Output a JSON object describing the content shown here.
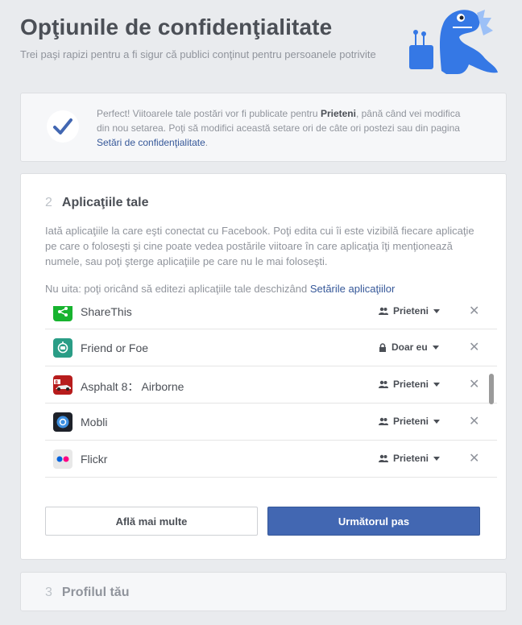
{
  "header": {
    "title": "Opţiunile de confidenţialitate",
    "subtitle": "Trei paşi rapizi pentru a fi sigur că publici conţinut pentru persoanele potrivite"
  },
  "confirmation": {
    "text_before": "Perfect! Viitoarele tale postări vor fi publicate pentru ",
    "audience": "Prieteni",
    "text_after": ", până când vei modifica din nou setarea. Poţi să modifici această setare ori de câte ori postezi sau din pagina ",
    "link": "Setări de confidenţialitate",
    "end": "."
  },
  "apps_step": {
    "number": "2",
    "title": "Aplicaţiile tale",
    "description": "Iată aplicaţiile la care eşti conectat cu Facebook. Poţi edita cui îi este vizibilă fiecare aplicaţie pe care o foloseşti şi cine poate vedea postările viitoare în care aplicaţia îţi menţionează numele, sau poţi şterge aplicaţiile pe care nu le mai foloseşti.",
    "note_prefix": "Nu uita: poţi oricând să editezi aplicaţiile tale deschizând ",
    "note_link": "Setările aplicaţiilor",
    "apps": [
      {
        "name": "ShareThis",
        "privacy": "Prieteni",
        "icon": "share-icon",
        "color": "#17b32f"
      },
      {
        "name": "Friend or Foe",
        "privacy": "Doar eu",
        "icon": "robot-icon",
        "color": "#2a9d86"
      },
      {
        "name": "Asphalt 8： Airborne",
        "privacy": "Prieteni",
        "icon": "race-car-icon",
        "color": "#b71c1c"
      },
      {
        "name": "Mobli",
        "privacy": "Prieteni",
        "icon": "mobli-icon",
        "color": "#1c5fa8"
      },
      {
        "name": "Flickr",
        "privacy": "Prieteni",
        "icon": "flickr-icon",
        "color": "#e8e8e8"
      }
    ],
    "learn_more": "Află mai multe",
    "next": "Următorul pas"
  },
  "profile_step": {
    "number": "3",
    "title": "Profilul tău"
  },
  "colors": {
    "primary": "#4267b2",
    "dino": "#3578e5"
  }
}
